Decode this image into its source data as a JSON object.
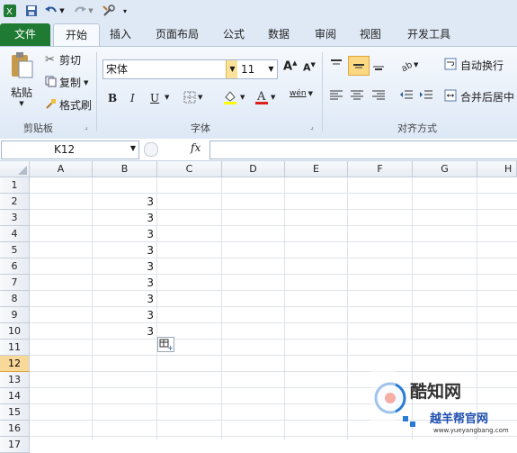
{
  "quick_access": {
    "icons": [
      "excel-icon",
      "save-icon",
      "undo-icon",
      "redo-icon",
      "customize-icon"
    ]
  },
  "tabs": [
    {
      "label": "文件"
    },
    {
      "label": "开始"
    },
    {
      "label": "插入"
    },
    {
      "label": "页面布局"
    },
    {
      "label": "公式"
    },
    {
      "label": "数据"
    },
    {
      "label": "审阅"
    },
    {
      "label": "视图"
    },
    {
      "label": "开发工具"
    }
  ],
  "ribbon": {
    "clipboard": {
      "paste_label": "粘贴",
      "cut_label": "剪切",
      "copy_label": "复制",
      "format_painter_label": "格式刷",
      "group_label": "剪贴板"
    },
    "font": {
      "font_name": "宋体",
      "font_size": "11",
      "bold": "B",
      "italic": "I",
      "underline": "U",
      "phonetic": "wén",
      "group_label": "字体"
    },
    "alignment": {
      "wrap_text_label": "自动换行",
      "merge_center_label": "合并后居中",
      "group_label": "对齐方式"
    }
  },
  "formula_bar": {
    "name_box": "K12",
    "fx_label": "fx",
    "formula": ""
  },
  "grid": {
    "columns": [
      "A",
      "B",
      "C",
      "D",
      "E",
      "F",
      "G",
      "H"
    ],
    "rows": [
      "1",
      "2",
      "3",
      "4",
      "5",
      "6",
      "7",
      "8",
      "9",
      "10",
      "11",
      "12",
      "13",
      "14",
      "15",
      "16",
      "17"
    ],
    "selected_row": "12",
    "column_b_values": [
      "",
      "3",
      "3",
      "3",
      "3",
      "3",
      "3",
      "3",
      "3",
      "3"
    ]
  },
  "watermark": {
    "brand": "酷知网",
    "subtitle": "越羊帮官网",
    "url": "www.yueyangbang.com"
  },
  "colors": {
    "file_tab": "#1f7a33",
    "selected_row_header": "#f9d99a",
    "ribbon_bg": "#dde8f6"
  }
}
